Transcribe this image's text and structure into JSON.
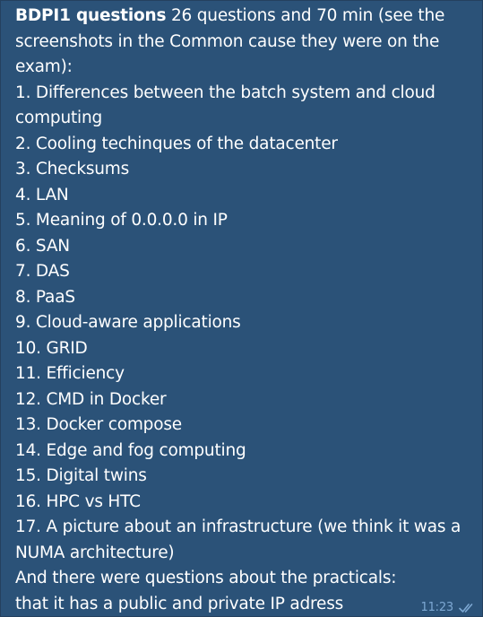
{
  "message": {
    "title_bold": "BDPI1 questions",
    "intro_rest": " 26 questions and 70 min (see the screenshots in the Common cause they were on the exam):",
    "questions": [
      "1. Differences between the batch system and cloud computing",
      "2. Cooling techinques of the datacenter",
      "3. Checksums",
      "4. LAN",
      "5. Meaning of 0.0.0.0 in IP",
      "6. SAN",
      "7. DAS",
      "8. PaaS",
      "9. Cloud-aware applications",
      "10. GRID",
      "11. Efficiency",
      "12. CMD in Docker",
      "13. Docker compose",
      "14. Edge and fog computing",
      "15. Digital twins",
      "16. HPC vs HTC",
      "17. A picture about an infrastructure (we think it was a NUMA architecture)"
    ],
    "footer_text": "And there were questions about the practicals: that it has a public and private IP adress",
    "time": "11:23",
    "status_icon": "double-check-icon"
  },
  "colors": {
    "bubble": "#2b5278",
    "background": "#0e1621",
    "text": "#ffffff",
    "meta": "#7da8d3"
  }
}
